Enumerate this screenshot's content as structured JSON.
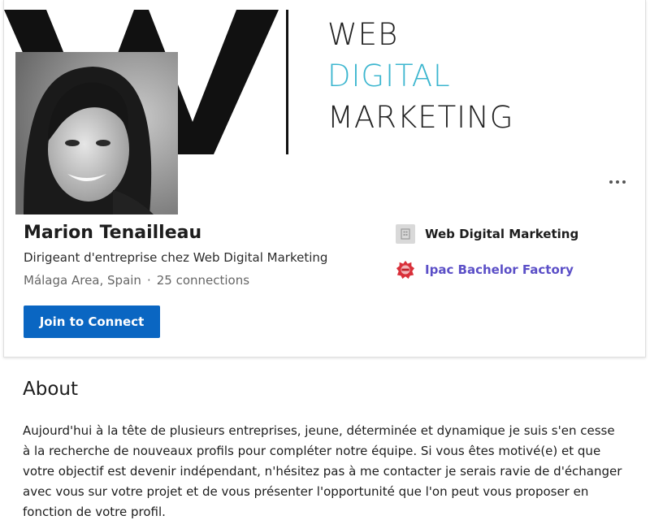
{
  "cover": {
    "line1": "WEB",
    "line2": "DIGITAL",
    "line3": "MARKETING",
    "accent_color": "#3cb6cf"
  },
  "profile": {
    "name": "Marion Tenailleau",
    "headline": "Dirigeant d'entreprise chez Web Digital Marketing",
    "location": "Málaga Area, Spain",
    "separator": "·",
    "connections": "25 connections",
    "join_label": "Join to Connect",
    "more_icon": "more-horizontal-icon"
  },
  "organizations": [
    {
      "name": "Web Digital Marketing",
      "icon": "company-building-icon",
      "color": "#1d1d1d"
    },
    {
      "name": "Ipac Bachelor Factory",
      "icon": "school-badge-icon",
      "color": "#5b4fc7"
    }
  ],
  "about": {
    "title": "About",
    "text": "Aujourd'hui à la tête de plusieurs entreprises, jeune, déterminée et dynamique je suis s'en cesse à la recherche de nouveaux profils pour compléter notre équipe. Si vous êtes motivé(e) et que votre objectif est devenir indépendant, n'hésitez pas à me contacter je serais ravie de d'échanger avec vous sur votre projet et de vous présenter l'opportunité que l'on peut vous proposer en fonction de votre profil."
  },
  "colors": {
    "primary_button": "#0a66c2",
    "link": "#5b4fc7"
  }
}
